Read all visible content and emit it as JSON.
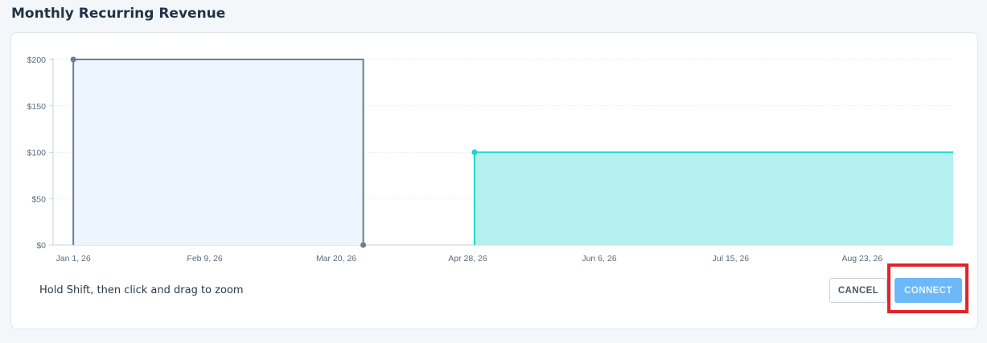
{
  "page": {
    "title": "Monthly Recurring Revenue"
  },
  "footer": {
    "hint": "Hold Shift, then click and drag to zoom",
    "cancel_label": "CANCEL",
    "connect_label": "CONNECT"
  },
  "colors": {
    "series_gray_line": "#6e7e8e",
    "series_gray_fill": "#edf5fe",
    "series_teal_line": "#1ed4cb",
    "series_teal_fill": "#b4f1ee",
    "highlight": "#e0242a"
  },
  "chart_data": {
    "type": "area",
    "title": "",
    "xlabel": "",
    "ylabel": "",
    "y_ticks": [
      "$0",
      "$50",
      "$100",
      "$150",
      "$200"
    ],
    "y_tick_values": [
      0,
      50,
      100,
      150,
      200
    ],
    "ylim": [
      0,
      200
    ],
    "x_ticks": [
      "Jan 1, 26",
      "Feb 9, 26",
      "Mar 20, 26",
      "Apr 28, 26",
      "Jun 6, 26",
      "Jul 15, 26",
      "Aug 23, 26"
    ],
    "x_tick_dates": [
      "2026-01-01",
      "2026-02-09",
      "2026-03-20",
      "2026-04-28",
      "2026-06-06",
      "2026-07-15",
      "2026-08-23"
    ],
    "xlim": [
      "2025-12-26",
      "2026-09-19"
    ],
    "grid": true,
    "series": [
      {
        "color": "#6e7e8e",
        "fill": "#edf5fe",
        "points": [
          {
            "x": "2026-01-01",
            "y": 200
          },
          {
            "x": "2026-03-28",
            "y": 200
          },
          {
            "x": "2026-03-28",
            "y": 0
          }
        ],
        "markers": [
          {
            "x": "2026-01-01",
            "y": 200
          },
          {
            "x": "2026-03-28",
            "y": 0
          }
        ]
      },
      {
        "color": "#1ed4cb",
        "fill": "#b4f1ee",
        "points": [
          {
            "x": "2026-04-30",
            "y": 0
          },
          {
            "x": "2026-04-30",
            "y": 100
          },
          {
            "x": "2026-09-19",
            "y": 100
          }
        ],
        "markers": [
          {
            "x": "2026-04-30",
            "y": 100
          }
        ]
      }
    ]
  }
}
